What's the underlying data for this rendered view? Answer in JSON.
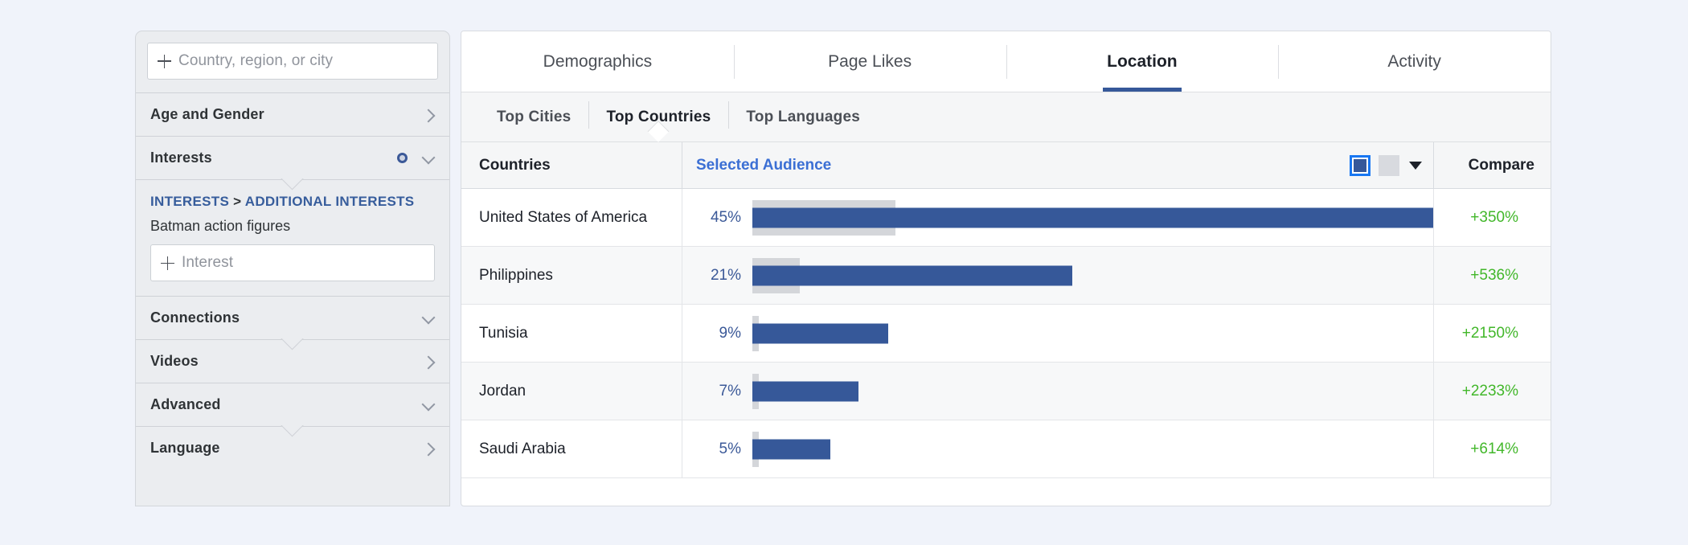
{
  "sidebar": {
    "location_search": {
      "placeholder": "Country, region, or city",
      "value": ""
    },
    "sections": [
      {
        "label": "Age and Gender",
        "icon": "chevron-right-icon"
      },
      {
        "label": "Interests",
        "icon": "chevron-down-icon",
        "secondary_icon": "target-dot-icon"
      }
    ],
    "interests_detail": {
      "breadcrumb_part1": "INTERESTS",
      "breadcrumb_sep": ">",
      "breadcrumb_part2": "ADDITIONAL INTERESTS",
      "selected_value": "Batman action figures",
      "add_placeholder": "Interest"
    },
    "more_sections": [
      {
        "label": "Connections",
        "icon": "chevron-down-icon"
      },
      {
        "label": "Videos",
        "icon": "chevron-right-icon"
      },
      {
        "label": "Advanced",
        "icon": "chevron-down-icon"
      },
      {
        "label": "Language",
        "icon": "chevron-right-icon"
      }
    ]
  },
  "main": {
    "tabs": [
      {
        "label": "Demographics",
        "active": false
      },
      {
        "label": "Page Likes",
        "active": false
      },
      {
        "label": "Location",
        "active": true
      },
      {
        "label": "Activity",
        "active": false
      }
    ],
    "subtabs": [
      {
        "label": "Top Cities",
        "active": false
      },
      {
        "label": "Top Countries",
        "active": true
      },
      {
        "label": "Top Languages",
        "active": false
      }
    ],
    "table": {
      "headers": {
        "country": "Countries",
        "audience": "Selected Audience",
        "compare": "Compare"
      },
      "legend": {
        "selected_swatch_color": "#365899",
        "compare_swatch_color": "#d8dadf",
        "dropdown_icon": "caret-down-icon"
      }
    }
  },
  "chart_data": {
    "type": "bar",
    "title": "Top Countries",
    "xlabel": "",
    "ylabel": "",
    "categories": [
      "United States of America",
      "Philippines",
      "Tunisia",
      "Jordan",
      "Saudi Arabia"
    ],
    "series": [
      {
        "name": "Selected Audience",
        "color": "#365899",
        "values": [
          45,
          21,
          9,
          7,
          5
        ],
        "labels": [
          "45%",
          "21%",
          "9%",
          "7%",
          "5%"
        ]
      },
      {
        "name": "Compare",
        "color": "#d4d6da",
        "values": [
          10,
          3.3,
          0.4,
          0.3,
          0.7
        ],
        "labels": [
          "+350%",
          "+536%",
          "+2150%",
          "+2233%",
          "+614%"
        ]
      }
    ],
    "xlim": [
      0,
      47
    ],
    "grid": false,
    "legend_position": "header-right",
    "rows": [
      {
        "country": "United States of America",
        "pct": "45%",
        "pct_value": 45,
        "bar_pct": 100.0,
        "gray_pct": 21.0,
        "compare": "+350%"
      },
      {
        "country": "Philippines",
        "pct": "21%",
        "pct_value": 21,
        "bar_pct": 47.0,
        "gray_pct": 7.0,
        "compare": "+536%"
      },
      {
        "country": "Tunisia",
        "pct": "9%",
        "pct_value": 9,
        "bar_pct": 20.0,
        "gray_pct": 0.9,
        "compare": "+2150%"
      },
      {
        "country": "Jordan",
        "pct": "7%",
        "pct_value": 7,
        "bar_pct": 15.6,
        "gray_pct": 0.9,
        "compare": "+2233%"
      },
      {
        "country": "Saudi Arabia",
        "pct": "5%",
        "pct_value": 5,
        "bar_pct": 11.5,
        "gray_pct": 0.9,
        "compare": "+614%"
      }
    ]
  }
}
